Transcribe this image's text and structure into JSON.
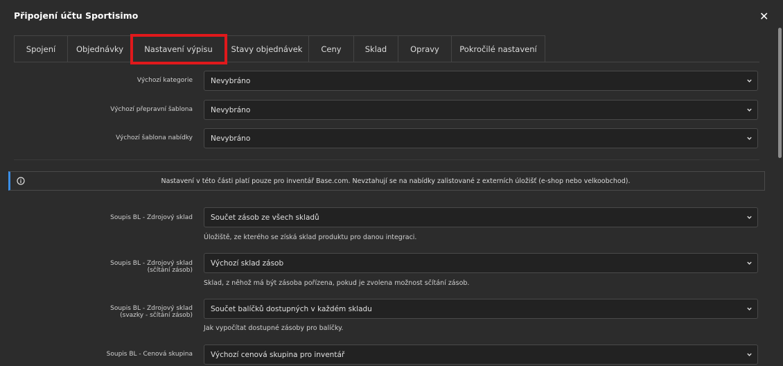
{
  "modal": {
    "title": "Připojení účtu Sportisimo",
    "close": "✕"
  },
  "tabs": [
    {
      "label": "Spojení"
    },
    {
      "label": "Objednávky"
    },
    {
      "label": "Nastavení výpisu"
    },
    {
      "label": "Stavy objednávek"
    },
    {
      "label": "Ceny"
    },
    {
      "label": "Sklad"
    },
    {
      "label": "Opravy"
    },
    {
      "label": "Pokročilé nastavení"
    }
  ],
  "active_tab": "Nastavení výpisu",
  "defaults": {
    "category": {
      "label": "Výchozí kategorie",
      "value": "Nevybráno"
    },
    "shipping": {
      "label": "Výchozí přepravní šablona",
      "value": "Nevybráno"
    },
    "offer": {
      "label": "Výchozí šablona nabídky",
      "value": "Nevybráno"
    }
  },
  "info": {
    "text": "Nastavení v této části platí pouze pro inventář Base.com. Nevztahují se na nabídky zalistované z externích úložišť (e-shop nebo velkoobchod)."
  },
  "inventory": {
    "source": {
      "label": "Soupis BL - Zdrojový sklad",
      "value": "Součet zásob ze všech skladů",
      "help": "Úložiště, ze kterého se získá sklad produktu pro danou integraci."
    },
    "source_sum": {
      "label_line1": "Soupis BL - Zdrojový sklad",
      "label_line2": "(sčítání zásob)",
      "value": "Výchozí sklad zásob",
      "help": "Sklad, z něhož má být zásoba pořízena, pokud je zvolena možnost sčítání zásob."
    },
    "source_bundle": {
      "label_line1": "Soupis BL - Zdrojový sklad",
      "label_line2": "(svazky - sčítání zásob)",
      "value": "Součet balíčků dostupných v každém skladu",
      "help": "Jak vypočítat dostupné zásoby pro balíčky."
    },
    "price_group": {
      "label": "Soupis BL - Cenová skupina",
      "value": "Výchozí cenová skupina pro inventář"
    }
  },
  "colors": {
    "background": "#2c2c2c",
    "highlight": "#e0191c",
    "info_accent": "#3b8ee6"
  }
}
